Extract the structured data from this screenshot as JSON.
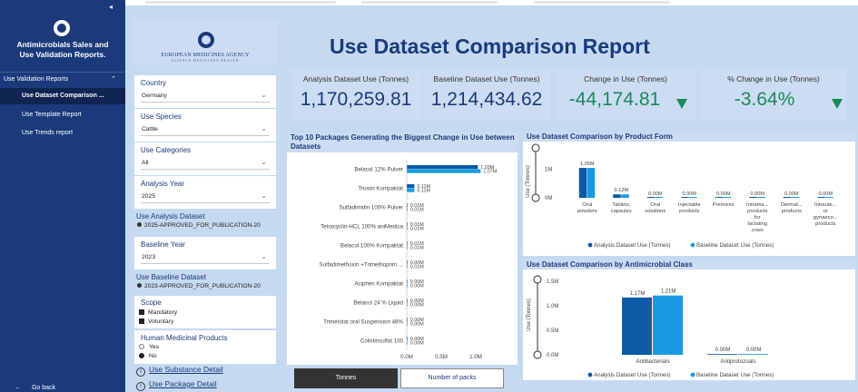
{
  "sidebar": {
    "title_line1": "Antimicrobials Sales and",
    "title_line2": "Use Validation Reports.",
    "collapse_glyph": "◂",
    "section_label": "Use Validation Reports",
    "items": [
      {
        "label": "Use Dataset Comparison ...",
        "active": true
      },
      {
        "label": "Use Template Report",
        "active": false
      },
      {
        "label": "Use Trends report",
        "active": false
      }
    ],
    "back_label": "Go back"
  },
  "brand": {
    "name": "EUROPEAN MEDICINES AGENCY",
    "tagline": "SCIENCE  MEDICINES  HEALTH"
  },
  "report_title": "Use Dataset Comparison Report",
  "filters": {
    "country": {
      "label": "Country",
      "value": "Germany"
    },
    "use_species": {
      "label": "Use Species",
      "value": "Cattle"
    },
    "use_categories": {
      "label": "Use Categories",
      "value": "All"
    },
    "analysis_year": {
      "label": "Analysis Year",
      "value": "2025"
    },
    "analysis_dataset": {
      "label": "Use Analysis Dataset",
      "value": "2025-APPROVED_FOR_PUBLICATION-20"
    },
    "baseline_year": {
      "label": "Baseline Year",
      "value": "2023"
    },
    "baseline_dataset": {
      "label": "Use Baseline Dataset",
      "value": "2023-APPROVED_FOR_PUBLICATION-20"
    },
    "scope": {
      "label": "Scope",
      "options": [
        "Mandatory",
        "Voluntary"
      ]
    },
    "human_medicinal": {
      "label": "Human Medicinal Products",
      "options": [
        "Yes",
        "No"
      ],
      "selected": "No"
    }
  },
  "links": {
    "substance_detail": "Use Substance Detail",
    "package_detail": "Use Package Detail"
  },
  "kpis": [
    {
      "label": "Analysis Dataset Use (Tonnes)",
      "value": "1,170,259.81"
    },
    {
      "label": "Baseline Dataset Use (Tonnes)",
      "value": "1,214,434.62"
    },
    {
      "label": "Change in Use (Tonnes)",
      "value": "-44,174.81"
    },
    {
      "label": "% Change in Use (Tonnes)",
      "value": "-3.64%"
    }
  ],
  "colors": {
    "analysis": "#0b5aa6",
    "baseline": "#1a9ae0",
    "sidebar": "#1a3a7a",
    "main_bg": "#c5d9f1",
    "negative": "#1a8a5a"
  },
  "toggle": {
    "tonnes": "Tonnes",
    "packs": "Number of packs"
  },
  "chart_data": [
    {
      "type": "bar",
      "orientation": "horizontal",
      "title": "Top 10 Packages Generating the Biggest Change in Use between Datasets",
      "categories": [
        "Belacol 12% Pulver",
        "Triosin Kompaktat",
        "Sulfadimidin 100% Pulver",
        "Tetracyclin-HCL 100% aniMedica",
        "Belacol 100% Kompaktat",
        "Sulfadimethoxin +Trimethoprim ...",
        "Aciphen Kompaktat",
        "Belacol 24 % Liquid",
        "Trimetotat oral Suspension 48%",
        "Colistinsulfat 100"
      ],
      "series": [
        {
          "name": "Analysis Dataset Use (Tonnes)",
          "values": [
            1.03,
            0.11,
            0.01,
            0.01,
            0.01,
            0.0,
            0.0,
            0.0,
            0.0,
            0.0
          ],
          "labels": [
            "1.03M",
            "0.11M",
            "0.01M",
            "0.01M",
            "0.01M",
            "0.00M",
            "0.00M",
            "0.00M",
            "0.00M",
            "0.00M"
          ]
        },
        {
          "name": "Baseline Dataset Use (Tonnes)",
          "values": [
            1.07,
            0.11,
            0.01,
            0.01,
            0.01,
            0.01,
            0.0,
            0.0,
            0.0,
            0.0
          ],
          "labels": [
            "1.07M",
            "0.11M",
            "0.01M",
            "0.01M",
            "0.01M",
            "0.01M",
            "0.00M",
            "0.00M",
            "0.00M",
            "0.00M"
          ]
        }
      ],
      "xlim": [
        0,
        1.0
      ],
      "ticks": [
        "0.0M",
        "0.5M",
        "1.0M"
      ],
      "legend": "bottom"
    },
    {
      "type": "bar",
      "title": "Use Dataset Comparison by Product Form",
      "ylabel": "Use (Tonnes)",
      "categories": [
        "Oral powders",
        "Tablets, capsules",
        "Oral solutions",
        "Injectable products",
        "Premixes",
        "Intrama... products for lactating cows",
        "Dermat... products",
        "Intraute... or gynaeco... products"
      ],
      "series": [
        {
          "name": "Analysis Dataset Use (Tonnes)",
          "values": [
            1.05,
            0.12,
            0.0,
            0.0,
            0.0,
            0.0,
            0.0,
            0.0
          ]
        },
        {
          "name": "Baseline Dataset Use (Tonnes)",
          "values": [
            1.05,
            0.12,
            0.0,
            0.0,
            0.0,
            0.0,
            0.0,
            0.0
          ]
        }
      ],
      "data_labels": [
        "1.05M",
        "0.12M",
        "0.00M",
        "0.00M",
        "0.00M",
        "0.00M",
        "0.00M",
        "0.00M"
      ],
      "ylim": [
        0,
        1.4
      ],
      "ticks": [
        "0M",
        "1M"
      ],
      "legend": "bottom"
    },
    {
      "type": "bar",
      "title": "Use Dataset Comparison by Antimicrobial Class",
      "ylabel": "Use (Tonnes)",
      "categories": [
        "Antibacterials",
        "Antiprotozoals"
      ],
      "series": [
        {
          "name": "Analysis Dataset Use (Tonnes)",
          "values": [
            1.17,
            0.0
          ],
          "labels": [
            "1.17M",
            "0.00M"
          ]
        },
        {
          "name": "Baseline Dataset Use (Tonnes)",
          "values": [
            1.21,
            0.0
          ],
          "labels": [
            "1.21M",
            "0.00M"
          ]
        }
      ],
      "ylim": [
        0,
        1.5
      ],
      "ticks": [
        "0.0M",
        "0.5M",
        "1.0M",
        "1.5M"
      ],
      "legend": "bottom"
    }
  ]
}
